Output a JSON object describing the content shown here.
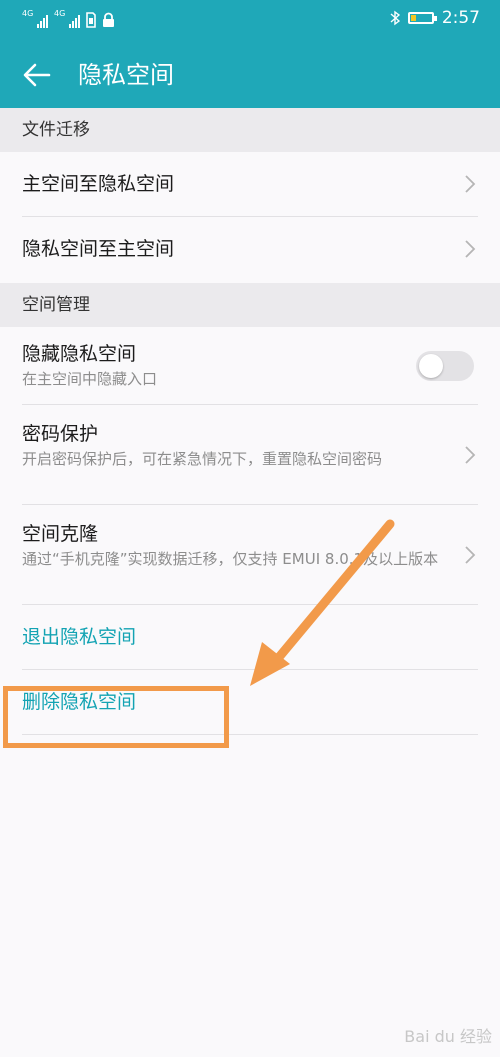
{
  "status_bar": {
    "network_1": "4G",
    "network_2": "4G",
    "time": "2:57",
    "icons": [
      "signal-icon",
      "signal-icon",
      "sim-icon",
      "lock-icon",
      "bluetooth-icon",
      "battery-icon"
    ],
    "battery_level": 0.25,
    "battery_color": "#f3c623"
  },
  "app_bar": {
    "title": "隐私空间",
    "color": "#1fa8b8"
  },
  "sections": {
    "file_migration": {
      "header": "文件迁移",
      "items": [
        {
          "label": "主空间至隐私空间"
        },
        {
          "label": "隐私空间至主空间"
        }
      ]
    },
    "space_management": {
      "header": "空间管理",
      "hide": {
        "label": "隐藏隐私空间",
        "desc": "在主空间中隐藏入口",
        "toggle_on": false
      },
      "password": {
        "label": "密码保护",
        "desc": "开启密码保护后，可在紧急情况下，重置隐私空间密码"
      },
      "clone": {
        "label": "空间克隆",
        "desc": "通过“手机克隆”实现数据迁移，仅支持 EMUI 8.0.1及以上版本"
      }
    }
  },
  "actions": {
    "exit": "退出隐私空间",
    "delete": "删除隐私空间",
    "accent_color": "#13a3b3"
  },
  "annotation": {
    "color": "#f29a4a"
  },
  "watermark": "Bai du 经验"
}
